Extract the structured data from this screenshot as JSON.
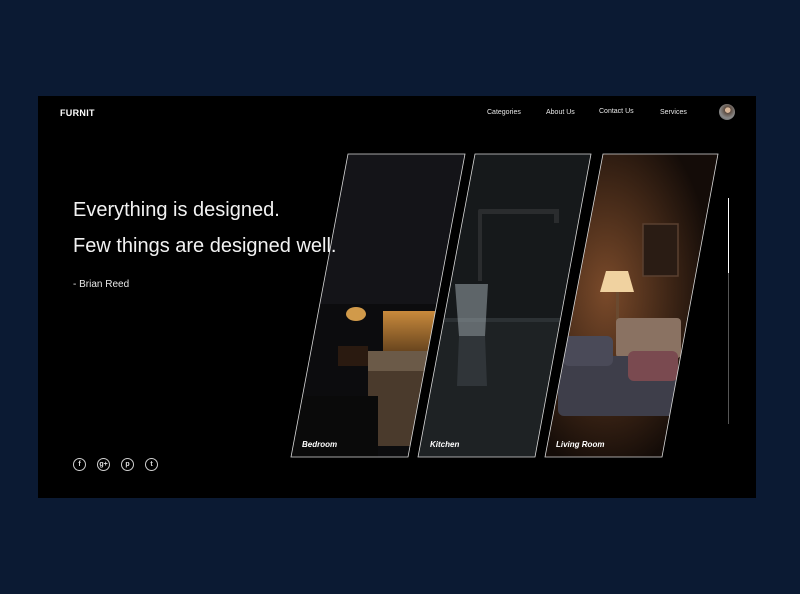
{
  "header": {
    "logo": "FURNIT",
    "nav": [
      {
        "label": "Categories"
      },
      {
        "label": "About Us"
      },
      {
        "label": "Contact Us"
      },
      {
        "label": "Services"
      }
    ]
  },
  "hero": {
    "quote_line1": "Everything is designed.",
    "quote_line2": "Few things are designed well.",
    "author": "- Brian Reed"
  },
  "categories": [
    {
      "label": "Bedroom"
    },
    {
      "label": "Kitchen"
    },
    {
      "label": "Living Room"
    }
  ],
  "social": [
    {
      "icon": "facebook-icon",
      "glyph": "f"
    },
    {
      "icon": "google-plus-icon",
      "glyph": "g+"
    },
    {
      "icon": "pinterest-icon",
      "glyph": "p"
    },
    {
      "icon": "twitter-icon",
      "glyph": "t"
    }
  ],
  "scroll": {
    "position_fraction": 0.33
  },
  "colors": {
    "page_bg": "#0b1a33",
    "frame_bg": "#000000",
    "text": "#ffffff"
  }
}
